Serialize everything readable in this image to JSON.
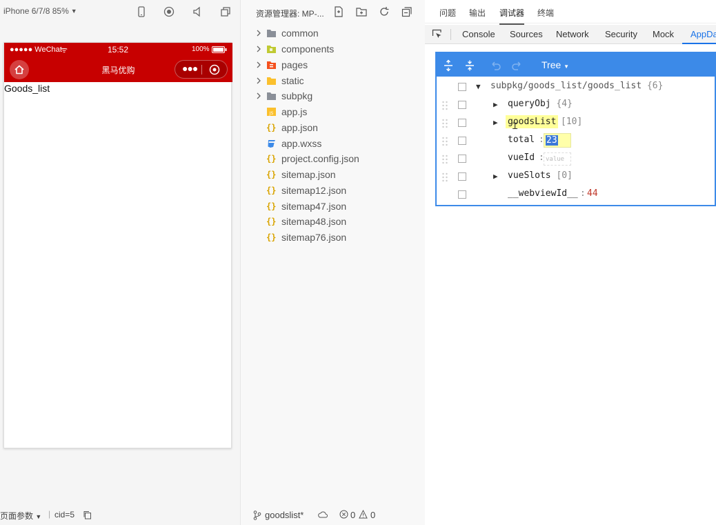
{
  "simulator": {
    "device": "iPhone 6/7/8 85%",
    "status": {
      "carrier": "●●●●● WeChat",
      "time": "15:52",
      "battery": "100%"
    },
    "nav_title": "黑马优购",
    "page_text": "Goods_list",
    "bottom": {
      "page_params": "页面参数",
      "cid": "cid=5"
    },
    "colors": {
      "nav": "#c70000"
    }
  },
  "explorer": {
    "title": "资源管理器: MP-...",
    "items": [
      {
        "name": "common",
        "type": "folder"
      },
      {
        "name": "components",
        "type": "folder"
      },
      {
        "name": "pages",
        "type": "folder"
      },
      {
        "name": "static",
        "type": "folder"
      },
      {
        "name": "subpkg",
        "type": "folder"
      },
      {
        "name": "app.js",
        "type": "js"
      },
      {
        "name": "app.json",
        "type": "json"
      },
      {
        "name": "app.wxss",
        "type": "css"
      },
      {
        "name": "project.config.json",
        "type": "json"
      },
      {
        "name": "sitemap.json",
        "type": "json"
      },
      {
        "name": "sitemap12.json",
        "type": "json"
      },
      {
        "name": "sitemap47.json",
        "type": "json"
      },
      {
        "name": "sitemap48.json",
        "type": "json"
      },
      {
        "name": "sitemap76.json",
        "type": "json"
      }
    ],
    "bottom": {
      "branch": "goodslist*",
      "errors": "0",
      "warnings": "0"
    }
  },
  "devtools": {
    "top_tabs": [
      "问题",
      "输出",
      "调试器",
      "终端"
    ],
    "tabs": [
      "Console",
      "Sources",
      "Network",
      "Security",
      "Mock",
      "AppDa"
    ],
    "active_tab": "AppDa",
    "appdata": {
      "mode": "Tree",
      "root": "subpkg/goods_list/goods_list",
      "root_count": "{6}",
      "rows": [
        {
          "key": "queryObj",
          "meta": "{4}",
          "expandable": true
        },
        {
          "key": "goodsList",
          "meta": "[10]",
          "expandable": true
        },
        {
          "key": "total",
          "value": "23",
          "editing": true
        },
        {
          "key": "vueId",
          "placeholder": "value",
          "editing": true
        },
        {
          "key": "vueSlots",
          "meta": "[0]",
          "expandable": true
        },
        {
          "key": "__webviewId__",
          "value": "44"
        }
      ]
    },
    "colors": {
      "accent": "#3c8ae8",
      "tab_active": "#1a73e8"
    }
  }
}
